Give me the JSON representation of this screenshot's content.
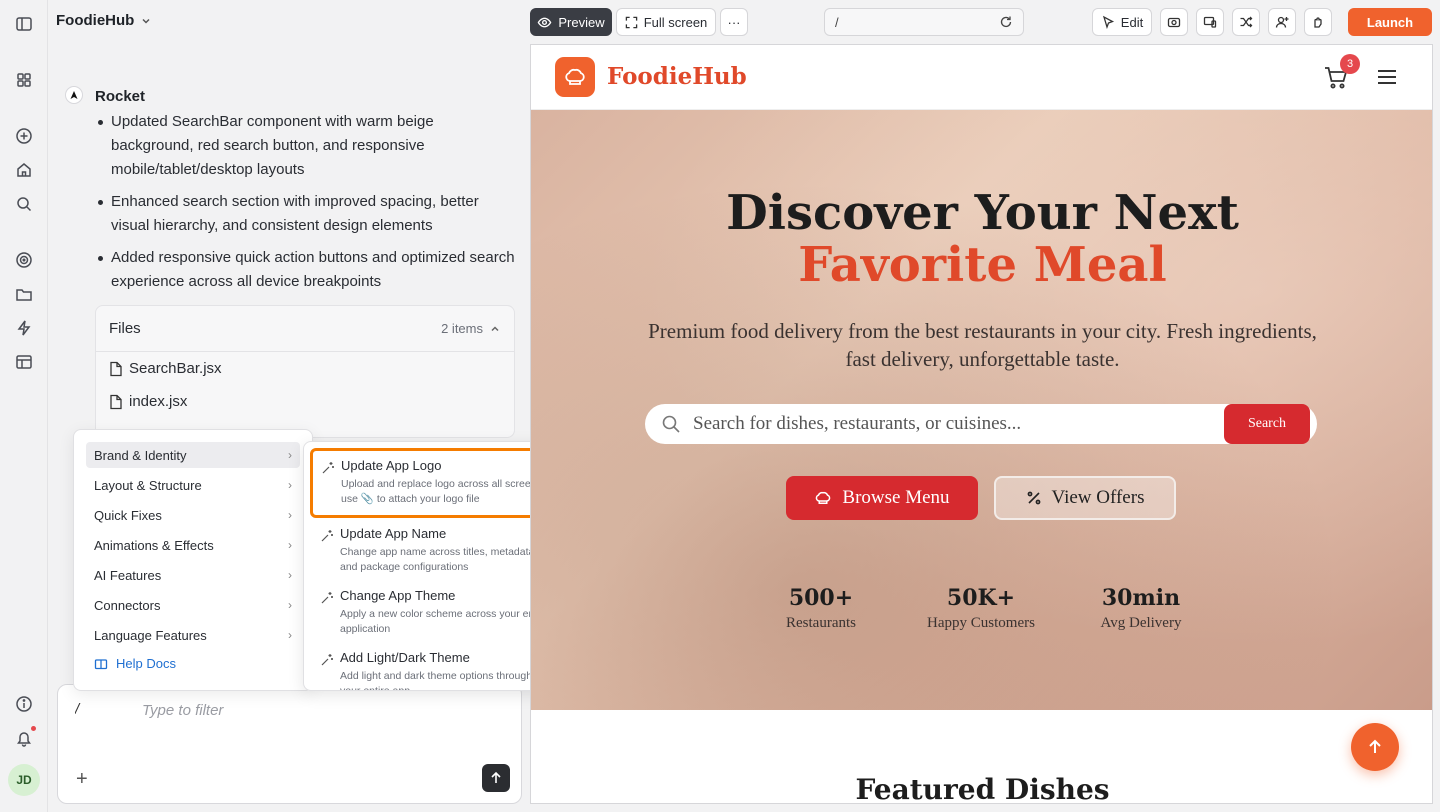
{
  "project": {
    "name": "FoodieHub"
  },
  "chat": {
    "assistant_name": "Rocket",
    "bullets": [
      "Updated SearchBar component with warm beige background, red search button, and responsive mobile/tablet/desktop layouts",
      "Enhanced search section with improved spacing, better visual hierarchy, and consistent design elements",
      "Added responsive quick action buttons and optimized search experience across all device breakpoints"
    ],
    "files": {
      "title": "Files",
      "count": "2 items",
      "items": [
        "SearchBar.jsx",
        "index.jsx"
      ]
    },
    "input": {
      "value": "/",
      "placeholder": "Type to filter"
    }
  },
  "menu": {
    "categories": [
      {
        "label": "Brand & Identity"
      },
      {
        "label": "Layout & Structure"
      },
      {
        "label": "Quick Fixes"
      },
      {
        "label": "Animations & Effects"
      },
      {
        "label": "AI Features"
      },
      {
        "label": "Connectors"
      },
      {
        "label": "Language Features"
      }
    ],
    "help": "Help Docs",
    "submenu": [
      {
        "title": "Update App Logo",
        "desc": "Upload and replace logo across all screens - use 📎 to attach your logo file"
      },
      {
        "title": "Update App Name",
        "desc": "Change app name across titles, metadata, and package configurations"
      },
      {
        "title": "Change App Theme",
        "desc": "Apply a new color scheme across your entire application"
      },
      {
        "title": "Add Light/Dark Theme",
        "desc": "Add light and dark theme options throughout your entire app"
      }
    ]
  },
  "toolbar": {
    "preview": "Preview",
    "fullscreen": "Full screen",
    "more": "···",
    "url": "/",
    "edit": "Edit",
    "launch": "Launch"
  },
  "site": {
    "name": "FoodieHub",
    "cart_count": "3",
    "hero_line1": "Discover Your Next",
    "hero_line2": "Favorite Meal",
    "subtitle": "Premium food delivery from the best restaurants in your city. Fresh ingredients, fast delivery, unforgettable taste.",
    "search_placeholder": "Search for dishes, restaurants, or cuisines...",
    "search_button": "Search",
    "browse_button": "Browse Menu",
    "offers_button": "View Offers",
    "stats": [
      {
        "value": "500+",
        "label": "Restaurants"
      },
      {
        "value": "50K+",
        "label": "Happy Customers"
      },
      {
        "value": "30min",
        "label": "Avg Delivery"
      }
    ],
    "featured_title": "Featured Dishes"
  },
  "user": {
    "initials": "JD"
  },
  "colors": {
    "brand": "#f0622d",
    "accent_red": "#d62a2f",
    "highlight": "#f57c00"
  }
}
